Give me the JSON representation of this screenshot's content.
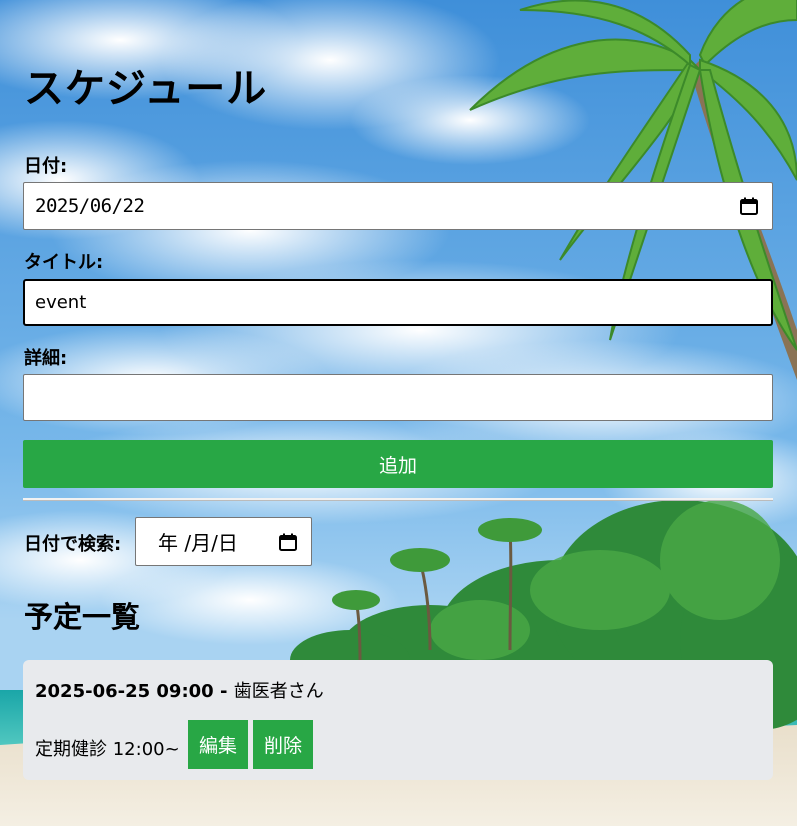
{
  "page": {
    "title": "スケジュール"
  },
  "form": {
    "date_label": "日付:",
    "date_value": "2025/06/22",
    "title_label": "タイトル:",
    "title_value": "event",
    "detail_label": "詳細:",
    "detail_value": "",
    "add_button": "追加"
  },
  "search": {
    "label": "日付で検索:",
    "placeholder": "年 /月/日"
  },
  "list": {
    "title": "予定一覧",
    "events": [
      {
        "datetime": "2025-06-25 09:00",
        "separator": " - ",
        "title": "歯医者さん",
        "detail": "定期健診 12:00~",
        "edit_label": "編集",
        "delete_label": "削除"
      }
    ]
  },
  "colors": {
    "accent": "#28a745",
    "card_bg": "#e8eaed"
  },
  "icons": {
    "date_picker": "calendar-icon",
    "search_picker": "calendar-icon"
  }
}
